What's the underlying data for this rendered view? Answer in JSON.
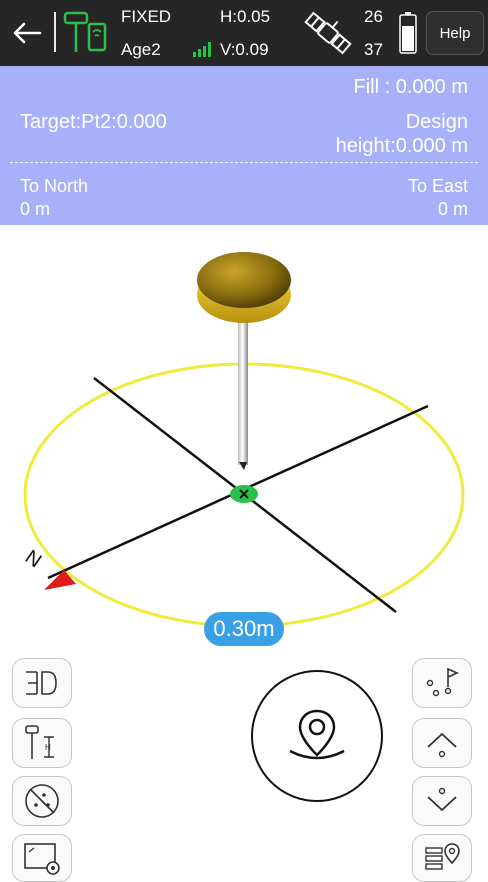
{
  "status_bar": {
    "solution": "FIXED",
    "age": "Age2",
    "h_precision": "H:0.05",
    "v_precision": "V:0.09",
    "satellites_used": "26",
    "satellites_visible": "37",
    "help_label": "Help"
  },
  "info_panel": {
    "fill": "Fill : 0.000 m",
    "target": "Target:Pt2:0.000",
    "design_label": "Design",
    "design_height": "height:0.000 m",
    "to_north_label": "To North",
    "to_north_value": "0 m",
    "to_east_label": "To East",
    "to_east_value": "0 m"
  },
  "scene": {
    "north_marker": "N",
    "distance_label": "0.30m"
  },
  "toolbar": {
    "left": [
      "3d-view-icon",
      "antenna-height-icon",
      "hide-points-icon",
      "screen-settings-icon"
    ],
    "right": [
      "point-flag-icon",
      "previous-point-icon",
      "next-point-icon",
      "point-list-icon"
    ],
    "center": "stakeout-locate-icon"
  },
  "colors": {
    "topbar": "#262626",
    "panel": "#a7b0f8",
    "accent_green": "#2bc04a",
    "circle": "#f2ea3a",
    "distance_badge": "#3aa0e6",
    "north_arrow": "#e01b1b"
  }
}
